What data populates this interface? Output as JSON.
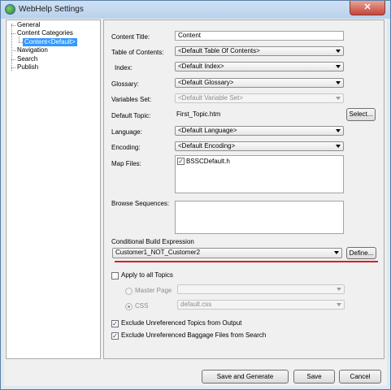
{
  "window": {
    "title": "WebHelp Settings",
    "close_label": "✕"
  },
  "tree": {
    "items": [
      {
        "label": "General"
      },
      {
        "label": "Content Categories"
      },
      {
        "label": "Content<Default>"
      },
      {
        "label": "Navigation"
      },
      {
        "label": "Search"
      },
      {
        "label": "Publish"
      }
    ]
  },
  "form": {
    "content_title": {
      "label": "Content Title:",
      "value": "Content"
    },
    "toc": {
      "label": "Table of Contents:",
      "value": "<Default Table Of Contents>"
    },
    "index": {
      "label": "Index:",
      "value": "<Default Index>"
    },
    "glossary": {
      "label": "Glossary:",
      "value": "<Default Glossary>"
    },
    "variables_set": {
      "label": "Variables Set:",
      "value": "<Default Variable Set>"
    },
    "default_topic": {
      "label": "Default Topic:",
      "value": "First_Topic.htm",
      "button": "Select..."
    },
    "language": {
      "label": "Language:",
      "value": "<Default Language>"
    },
    "encoding": {
      "label": "Encoding:",
      "value": "<Default Encoding>"
    },
    "map_files": {
      "label": "Map Files:",
      "items": [
        {
          "name": "BSSCDefault.h",
          "checked": true
        }
      ]
    },
    "browse_sequences": {
      "label": "Browse Sequences:"
    },
    "conditional": {
      "label": "Conditional Build Expression",
      "value": "Customer1_NOT_Customer2",
      "button": "Define...",
      "highlight_color": "#e0192a"
    },
    "apply_all": {
      "label": "Apply to all Topics",
      "checked": false
    },
    "master_page": {
      "label": "Master Page",
      "value": ""
    },
    "css": {
      "label": "CSS",
      "value": "default.css"
    },
    "exclude_topics": {
      "label": "Exclude Unreferenced Topics from Output",
      "checked": true
    },
    "exclude_baggage": {
      "label": "Exclude Unreferenced Baggage Files from Search",
      "checked": true
    }
  },
  "buttons": {
    "save_generate": "Save and Generate",
    "save": "Save",
    "cancel": "Cancel"
  }
}
